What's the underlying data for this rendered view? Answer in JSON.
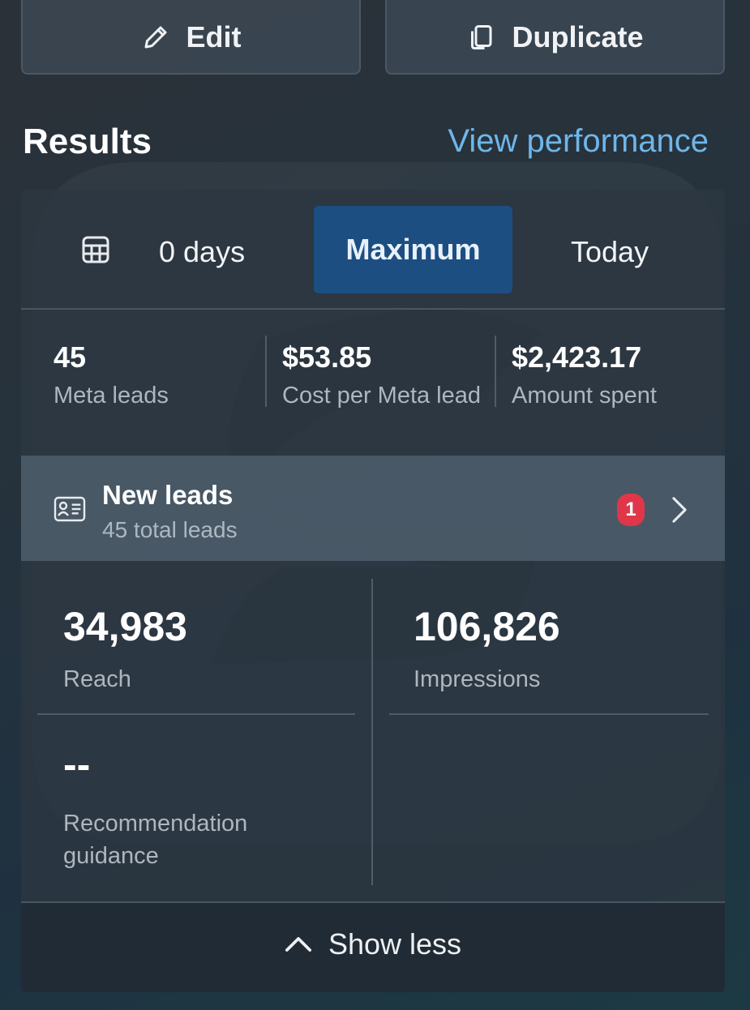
{
  "actions": {
    "edit_label": "Edit",
    "duplicate_label": "Duplicate"
  },
  "results": {
    "title": "Results",
    "view_performance_link": "View performance"
  },
  "date_range": {
    "days_label": "0 days",
    "options": [
      "Maximum",
      "Today"
    ],
    "selected": "Maximum"
  },
  "summary": [
    {
      "value": "45",
      "label": "Meta leads"
    },
    {
      "value": "$53.85",
      "label": "Cost per Meta lead"
    },
    {
      "value": "$2,423.17",
      "label": "Amount spent"
    }
  ],
  "leads": {
    "title": "New leads",
    "subtitle": "45 total leads",
    "badge_count": "1"
  },
  "metrics": [
    {
      "value": "34,983",
      "label": "Reach"
    },
    {
      "value": "106,826",
      "label": "Impressions"
    },
    {
      "value": "--",
      "label": "Recommendation guidance"
    }
  ],
  "footer": {
    "show_less_label": "Show less"
  },
  "colors": {
    "accent_link": "#6fb6ea",
    "selected_range_bg": "#1d4e82",
    "badge_red": "#e0364a"
  },
  "icons": [
    "pencil-icon",
    "duplicate-icon",
    "calendar-icon",
    "lead-card-icon",
    "chevron-right-icon",
    "chevron-up-icon"
  ]
}
